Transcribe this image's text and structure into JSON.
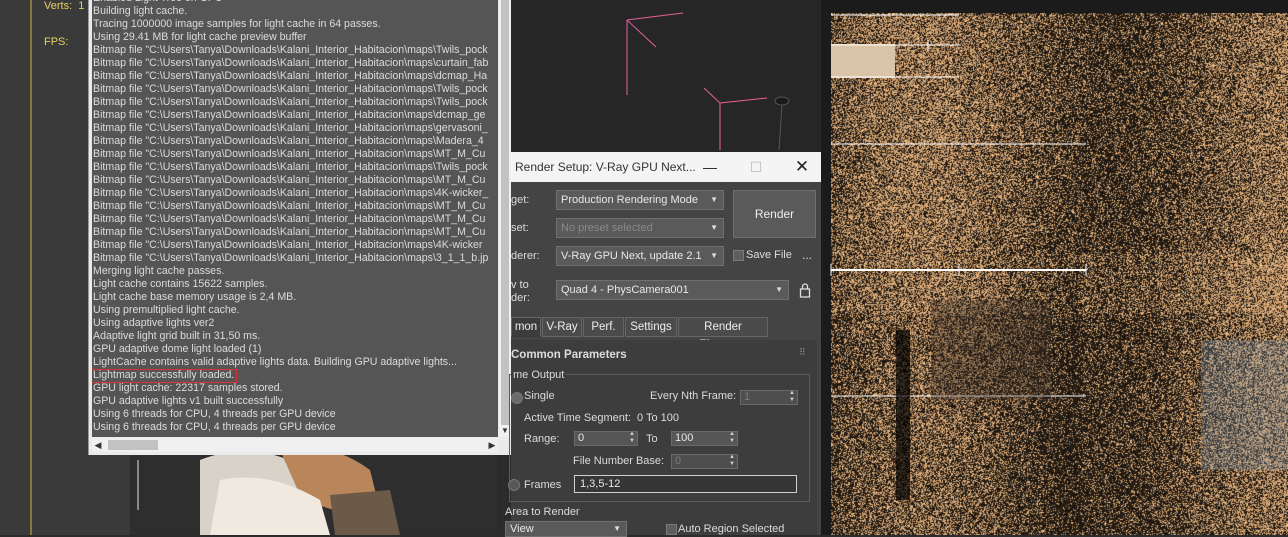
{
  "viewport_left": {
    "stats": {
      "verts_label": "Verts:",
      "verts_value": "1",
      "fps_label": "FPS:"
    }
  },
  "log": {
    "lines": [
      "Enabled Light Tree on GPU",
      "Building light cache.",
      "Tracing 1000000 image samples for light cache in 64 passes.",
      "Using 29.41 MB for light cache preview buffer",
      "Bitmap file \"C:\\Users\\Tanya\\Downloads\\Kalani_Interior_Habitacion\\maps\\Twils_pock",
      "Bitmap file \"C:\\Users\\Tanya\\Downloads\\Kalani_Interior_Habitacion\\maps\\curtain_fab",
      "Bitmap file \"C:\\Users\\Tanya\\Downloads\\Kalani_Interior_Habitacion\\maps\\dcmap_Ha",
      "Bitmap file \"C:\\Users\\Tanya\\Downloads\\Kalani_Interior_Habitacion\\maps\\Twils_pock",
      "Bitmap file \"C:\\Users\\Tanya\\Downloads\\Kalani_Interior_Habitacion\\maps\\Twils_pock",
      "Bitmap file \"C:\\Users\\Tanya\\Downloads\\Kalani_Interior_Habitacion\\maps\\dcmap_ge",
      "Bitmap file \"C:\\Users\\Tanya\\Downloads\\Kalani_Interior_Habitacion\\maps\\gervasoni_",
      "Bitmap file \"C:\\Users\\Tanya\\Downloads\\Kalani_Interior_Habitacion\\maps\\Madera_4",
      "Bitmap file \"C:\\Users\\Tanya\\Downloads\\Kalani_Interior_Habitacion\\maps\\MT_M_Cu",
      "Bitmap file \"C:\\Users\\Tanya\\Downloads\\Kalani_Interior_Habitacion\\maps\\Twils_pock",
      "Bitmap file \"C:\\Users\\Tanya\\Downloads\\Kalani_Interior_Habitacion\\maps\\MT_M_Cu",
      "Bitmap file \"C:\\Users\\Tanya\\Downloads\\Kalani_Interior_Habitacion\\maps\\4K-wicker_",
      "Bitmap file \"C:\\Users\\Tanya\\Downloads\\Kalani_Interior_Habitacion\\maps\\MT_M_Cu",
      "Bitmap file \"C:\\Users\\Tanya\\Downloads\\Kalani_Interior_Habitacion\\maps\\MT_M_Cu",
      "Bitmap file \"C:\\Users\\Tanya\\Downloads\\Kalani_Interior_Habitacion\\maps\\MT_M_Cu",
      "Bitmap file \"C:\\Users\\Tanya\\Downloads\\Kalani_Interior_Habitacion\\maps\\4K-wicker",
      "Bitmap file \"C:\\Users\\Tanya\\Downloads\\Kalani_Interior_Habitacion\\maps\\3_1_1_b.jp",
      "Merging light cache passes.",
      "Light cache contains 15622 samples.",
      "Light cache base memory usage is 2,4 MB.",
      "Using premultiplied light cache.",
      "Using adaptive lights ver2",
      "Adaptive light grid built in 31,50 ms.",
      "GPU adaptive dome light loaded (1)",
      "LightCache contains valid adaptive lights data. Building GPU adaptive lights...",
      "Lightmap successfully loaded.",
      "GPU light cache: 22317 samples stored.",
      "GPU adaptive lights v1 built successfully",
      "Using 6 threads for CPU, 4 threads per GPU device",
      "Using 6 threads for CPU, 4 threads per GPU device"
    ],
    "highlighted_line": "Lightmap successfully loaded."
  },
  "render_setup": {
    "title": "Render Setup: V-Ray GPU Next...",
    "target_label": "get:",
    "target_value": "Production Rendering Mode",
    "preset_label": "set:",
    "preset_value": "No preset selected",
    "renderer_label": "derer:",
    "renderer_value": "V-Ray GPU Next, update 2.1",
    "save_file_label": "Save File",
    "ellipsis_label": "...",
    "view_label_1": "v to",
    "view_label_2": "der:",
    "view_value": "Quad 4 - PhysCamera001",
    "render_button": "Render",
    "tabs": [
      {
        "label": "mon"
      },
      {
        "label": "V-Ray"
      },
      {
        "label": "Perf."
      },
      {
        "label": "Settings"
      },
      {
        "label": "Render Elements"
      }
    ],
    "rollout_title": "Common Parameters",
    "time_output_label": "me Output",
    "single_label": "Single",
    "every_nth_label": "Every Nth Frame:",
    "every_nth_value": "1",
    "active_segment_label": "Active Time Segment:",
    "active_segment_value": "0 To 100",
    "range_label": "Range:",
    "range_from": "0",
    "to_label": "To",
    "range_to": "100",
    "file_number_base_label": "File Number Base:",
    "file_number_base_value": "0",
    "frames_label": "Frames",
    "frames_value": "1,3,5-12",
    "area_to_render_label": "Area to Render",
    "area_value": "View",
    "auto_region_label": "Auto Region Selected"
  },
  "colors": {
    "log_bg": "#555555",
    "dialog_bg": "#444444",
    "highlight_border": "#e03030",
    "stats_text": "#e8d060",
    "gizmo_pink": "#e8609a"
  }
}
